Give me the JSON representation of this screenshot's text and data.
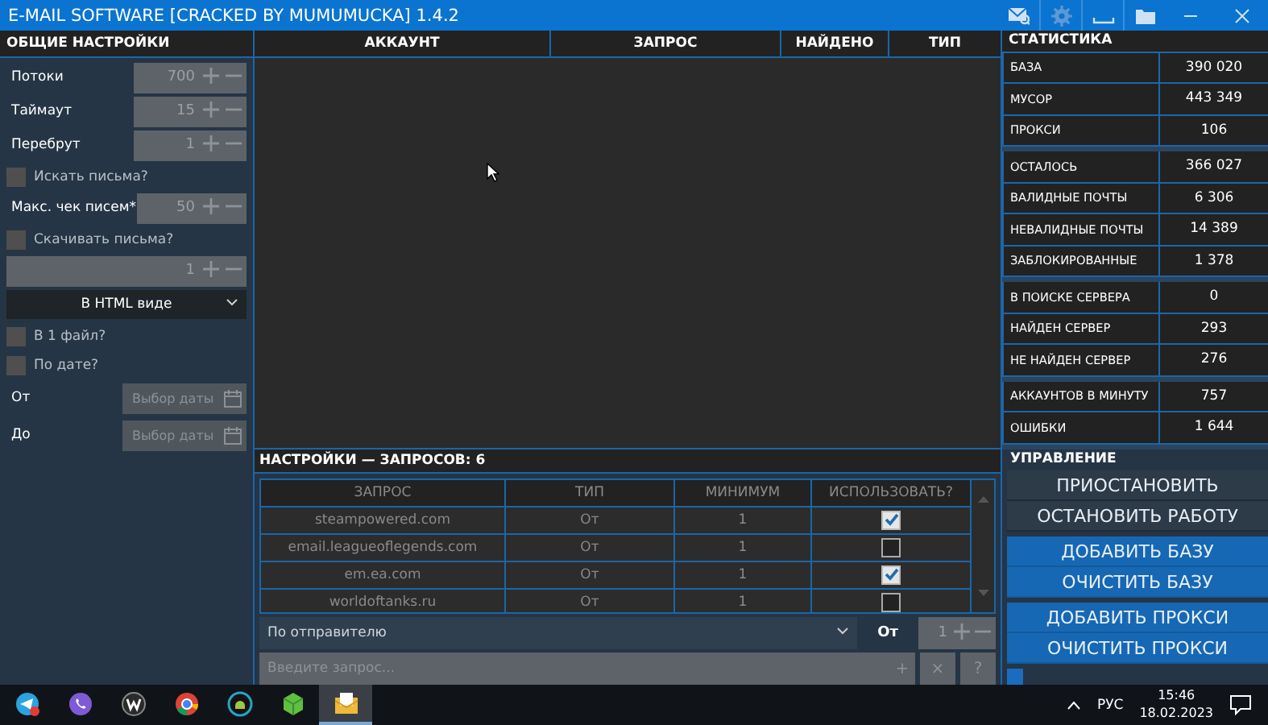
{
  "window": {
    "title": "E-MAIL SOFTWARE [CRACKED BY MUMUMUCKA] 1.4.2"
  },
  "settings": {
    "title": "ОБЩИЕ НАСТРОЙКИ",
    "items": [
      {
        "kind": "spinner",
        "label": "Потоки",
        "value": "700"
      },
      {
        "kind": "spinner",
        "label": "Таймаут",
        "value": "15"
      },
      {
        "kind": "spinner",
        "label": "Перебрут",
        "value": "1"
      },
      {
        "kind": "checkbox",
        "label": "Искать письма?",
        "checked": false
      },
      {
        "kind": "spinner",
        "label": "Макс. чек писем*",
        "value": "50"
      },
      {
        "kind": "checkbox",
        "label": "Скачивать письма?",
        "checked": false
      },
      {
        "kind": "spinner",
        "value": "1"
      },
      {
        "kind": "select",
        "value": "В HTML виде"
      },
      {
        "kind": "checkbox",
        "label": "В 1 файл?",
        "checked": false
      },
      {
        "kind": "checkbox",
        "label": "По дате?",
        "checked": false
      },
      {
        "kind": "date",
        "label": "От",
        "placeholder": "Выбор даты"
      },
      {
        "kind": "date",
        "label": "До",
        "placeholder": "Выбор даты"
      }
    ]
  },
  "results": {
    "columns": [
      "АККАУНТ",
      "ЗАПРОС",
      "НАЙДЕНО",
      "ТИП"
    ]
  },
  "queries": {
    "title": "НАСТРОЙКИ — ЗАПРОСОВ: 6",
    "columns": [
      "ЗАПРОС",
      "ТИП",
      "МИНИМУМ",
      "ИСПОЛЬЗОВАТЬ?"
    ],
    "rows": [
      {
        "query": "steampowered.com",
        "type": "От",
        "minimum": "1",
        "checked": true
      },
      {
        "query": "email.leagueoflegends.com",
        "type": "От",
        "minimum": "1",
        "checked": false
      },
      {
        "query": "em.ea.com",
        "type": "От",
        "minimum": "1",
        "checked": true
      },
      {
        "query": "worldoftanks.ru",
        "type": "От",
        "minimum": "1",
        "checked": false
      }
    ],
    "filter": "По отправителю",
    "type_label": "От",
    "minimum": "1",
    "query_placeholder": "Введите запрос...",
    "buttons": [
      "+",
      "×",
      "?"
    ]
  },
  "statistics": {
    "title": "СТАТИСТИКА",
    "groups": [
      [
        {
          "label": "БАЗА",
          "value": "390 020"
        },
        {
          "label": "МУСОР",
          "value": "443 349"
        },
        {
          "label": "ПРОКСИ",
          "value": "106"
        }
      ],
      [
        {
          "label": "ОСТАЛОСЬ",
          "value": "366 027"
        },
        {
          "label": "ВАЛИДНЫЕ ПОЧТЫ",
          "value": "6 306"
        },
        {
          "label": "НЕВАЛИДНЫЕ ПОЧТЫ",
          "value": "14 389"
        },
        {
          "label": "ЗАБЛОКИРОВАННЫЕ",
          "value": "1 378"
        }
      ],
      [
        {
          "label": "В ПОИСКЕ СЕРВЕРА",
          "value": "0"
        },
        {
          "label": "НАЙДЕН СЕРВЕР",
          "value": "293"
        },
        {
          "label": "НЕ НАЙДЕН СЕРВЕР",
          "value": "276"
        }
      ],
      [
        {
          "label": "АККАУНТОВ В МИНУТУ",
          "value": "757"
        },
        {
          "label": "ОШИБКИ",
          "value": "1 644"
        }
      ]
    ]
  },
  "control": {
    "title": "УПРАВЛЕНИЕ",
    "groups": [
      [
        {
          "kind": "dark",
          "label": "ПРИОСТАНОВИТЬ"
        },
        {
          "kind": "dark",
          "label": "ОСТАНОВИТЬ РАБОТУ"
        }
      ],
      [
        {
          "kind": "blue",
          "label": "ДОБАВИТЬ БАЗУ"
        },
        {
          "kind": "blue",
          "label": "ОЧИСТИТЬ БАЗУ"
        }
      ],
      [
        {
          "kind": "blue",
          "label": "ДОБАВИТЬ ПРОКСИ"
        },
        {
          "kind": "blue",
          "label": "ОЧИСТИТЬ ПРОКСИ"
        }
      ]
    ],
    "load": {
      "level": 0.06
    }
  },
  "taskbar": {
    "apps": [
      {
        "selected": false
      },
      {
        "selected": false
      },
      {
        "selected": false
      },
      {
        "selected": false
      },
      {
        "selected": false
      },
      {
        "selected": false
      },
      {
        "selected": true
      }
    ],
    "language": "РУС",
    "time": "15:46",
    "date": "18.02.2023"
  }
}
